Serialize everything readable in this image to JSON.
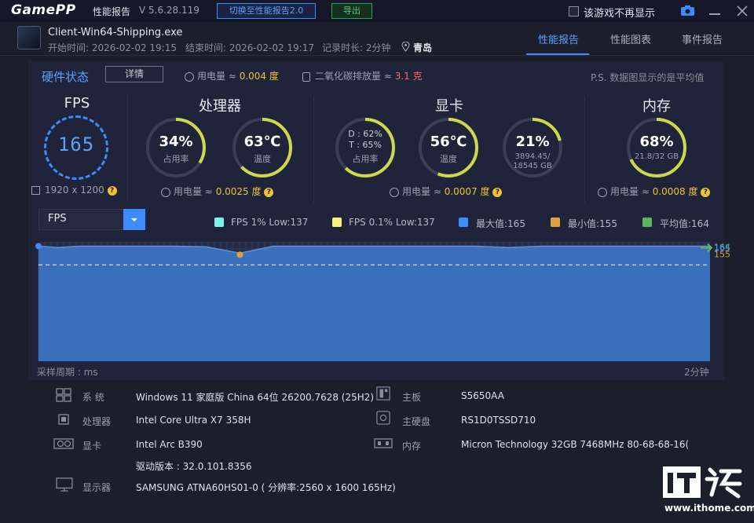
{
  "titlebar": {
    "logo": "GamePP",
    "title": "性能报告",
    "version": "V 5.6.28.119",
    "switch_button": "切换至性能报告2.0",
    "export_button": "导出",
    "hide_label": "该游戏不再显示"
  },
  "process": {
    "name": "Client-Win64-Shipping.exe",
    "start": "开始时间: 2026-02-02 19:15",
    "end": "结束时间: 2026-02-02 19:17",
    "duration": "记录时长: 2分钟",
    "location": "青岛"
  },
  "tabs": [
    "性能报告",
    "性能图表",
    "事件报告"
  ],
  "hardware": {
    "title": "硬件状态",
    "detail_button": "详情",
    "power_label": "用电量 ≈ ",
    "power_value": "0.004 度",
    "co2_label": "二氧化碳排放量 ≈ ",
    "co2_value": "3.1 克",
    "note": "P.S. 数据图显示的是平均值"
  },
  "fps_section": {
    "title": "FPS",
    "value": "165",
    "resolution": "1920 x 1200"
  },
  "cpu_section": {
    "title": "处理器",
    "usage": {
      "value": "34%",
      "label": "占用率",
      "level": 0.34
    },
    "temp": {
      "value": "63℃",
      "label": "温度",
      "level": 0.63
    },
    "power_label": "用电量 ≈ ",
    "power_value": "0.0025 度"
  },
  "gpu_section": {
    "title": "显卡",
    "usage": {
      "line1": "D : 62%",
      "line2": "T : 65%",
      "label": "占用率",
      "level": 0.62
    },
    "temp": {
      "value": "56℃",
      "label": "温度",
      "level": 0.56
    },
    "vram": {
      "value": "21%",
      "line1": "3894.45/",
      "line2": "18545 GB",
      "level": 0.21
    },
    "power_label": "用电量 ≈ ",
    "power_value": "0.0007 度"
  },
  "mem_section": {
    "title": "内存",
    "usage": {
      "value": "68%",
      "sub": "21.8/32 GB",
      "level": 0.68
    },
    "power_label": "用电量 ≈ ",
    "power_value": "0.0008 度"
  },
  "chart_controls": {
    "selected_metric": "FPS",
    "legend": [
      {
        "label": "FPS 1% Low:137",
        "color": "#7ff2ea"
      },
      {
        "label": "FPS 0.1% Low:137",
        "color": "#f7f07a"
      },
      {
        "label": "最大值:165",
        "color": "#3c8cff"
      },
      {
        "label": "最小值:155",
        "color": "#e0a040"
      },
      {
        "label": "平均值:164",
        "color": "#5cb85c"
      }
    ]
  },
  "chart_data": {
    "type": "area",
    "title": "",
    "xlabel": "采样周期 : ms",
    "x_end_label": "2分钟",
    "ylabel": "",
    "ylim": [
      0,
      170
    ],
    "x": [
      0,
      3,
      6,
      10,
      15,
      20,
      25,
      30,
      35,
      40,
      45,
      50,
      55,
      60,
      65,
      70,
      75,
      80,
      85,
      90,
      95,
      100
    ],
    "values": [
      165,
      163,
      165,
      165,
      165,
      165,
      164,
      155,
      165,
      165,
      165,
      165,
      165,
      165,
      165,
      163,
      165,
      165,
      165,
      165,
      165,
      165
    ],
    "avg": 164,
    "max": 165,
    "min": 155,
    "right_labels": [
      "164",
      "165",
      "155"
    ],
    "grid": true,
    "series_color": "#3c78c8"
  },
  "system_info": {
    "os_label": "系    统",
    "os_value": "Windows 11 家庭版 China 64位 26200.7628 (25H2)",
    "cpu_label": "处理器",
    "cpu_value": "Intel Core Ultra X7 358H",
    "gpu_label": "显卡",
    "gpu_value": "Intel Arc B390",
    "driver_value": "驱动版本 : 32.0.101.8356",
    "monitor_label": "显示器",
    "monitor_value": "SAMSUNG ATNA60HS01-0 ( 分辨率:2560 x 1600 165Hz)",
    "board_label": "主板",
    "board_value": "S5650AA",
    "disk_label": "主硬盘",
    "disk_value": "RS1D0TSSD710",
    "mem_label": "内存",
    "mem_value": "Micron Technology 32GB 7468MHz 80-68-68-16("
  },
  "watermark": {
    "logo": "IT之家",
    "url": "www.ithome.com"
  }
}
